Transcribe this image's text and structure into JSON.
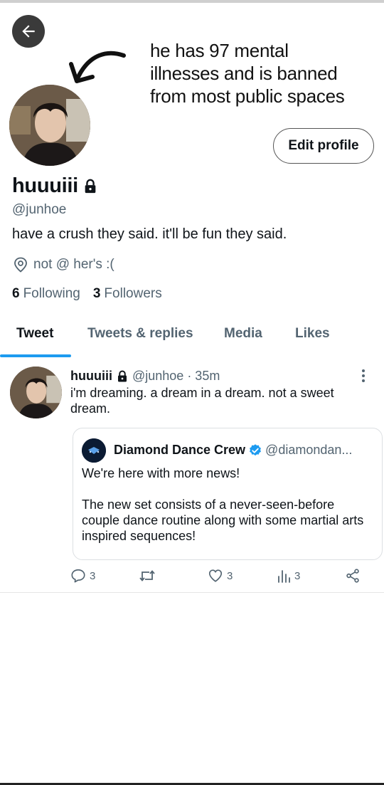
{
  "caption": {
    "line1": "he has 97 mental",
    "line2": "illnesses and is banned",
    "line3": "from most public spaces"
  },
  "profile": {
    "name": "huuuiii",
    "handle": "@junhoe",
    "bio": "have a crush they said. it'll be fun they said.",
    "location": "not @ her's :(",
    "following_count": "6",
    "following_label": "Following",
    "followers_count": "3",
    "followers_label": "Followers",
    "edit_label": "Edit profile"
  },
  "tabs": [
    {
      "label": "Tweet"
    },
    {
      "label": "Tweets & replies"
    },
    {
      "label": "Media"
    },
    {
      "label": "Likes"
    }
  ],
  "tweet": {
    "name": "huuuiii",
    "handle": "@junhoe",
    "time": "· 35m",
    "text": "i'm dreaming. a dream in a dream. not a sweet dream.",
    "quote": {
      "name": "Diamond Dance Crew",
      "handle": "@diamondan...",
      "para1": "We're here with more news!",
      "para2": "The new set consists of a never-seen-before couple dance routine along with some martial arts inspired sequences!"
    },
    "actions": {
      "replies": "3",
      "likes": "3",
      "views": "3"
    }
  },
  "colors": {
    "accent": "#1d9bf0",
    "muted": "#536471",
    "text": "#0f1419"
  }
}
